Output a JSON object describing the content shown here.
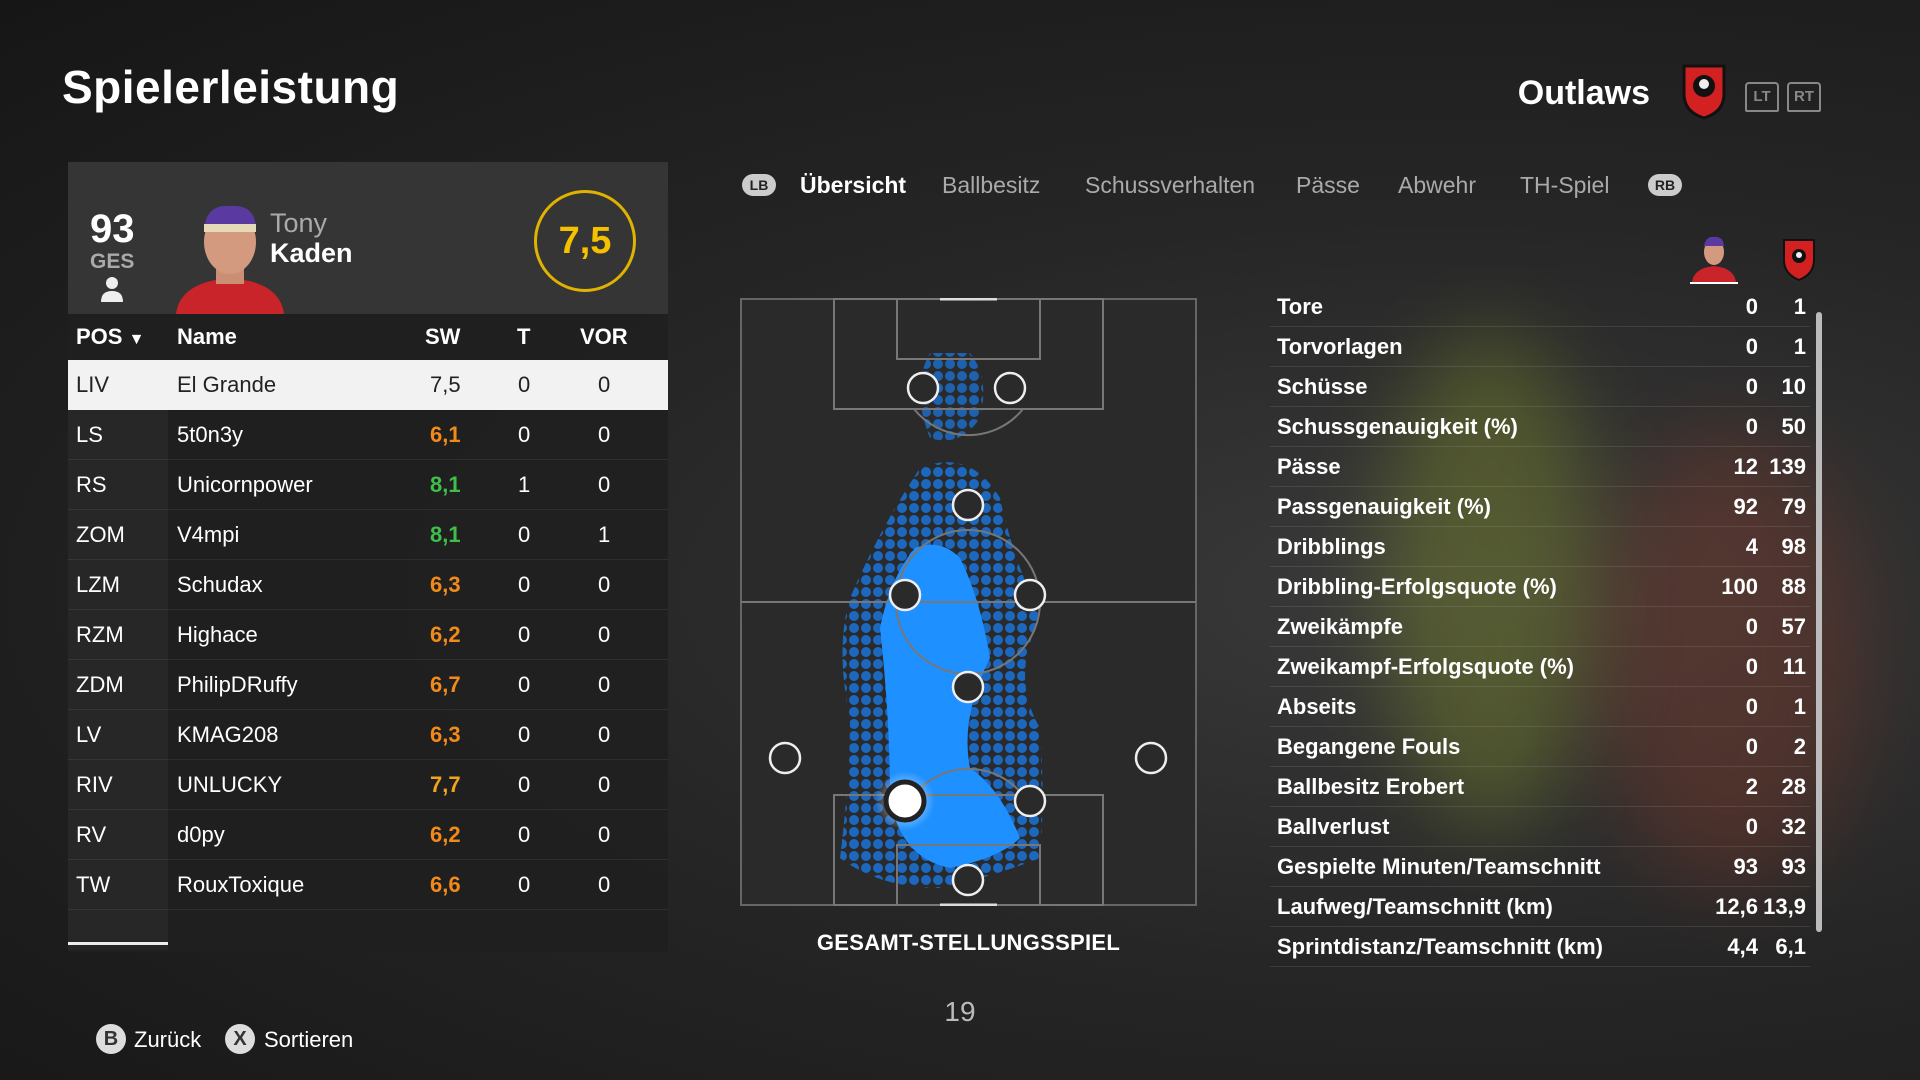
{
  "page_title": "Spielerleistung",
  "team": {
    "name": "Outlaws"
  },
  "triggers": {
    "lt": "LT",
    "rt": "RT"
  },
  "player": {
    "overall": "93",
    "overall_label": "GES",
    "first_name": "Tony",
    "last_name": "Kaden",
    "rating": "7,5"
  },
  "table": {
    "headers": {
      "pos": "POS",
      "name": "Name",
      "sw": "SW",
      "t": "T",
      "vor": "VOR"
    },
    "rows": [
      {
        "pos": "LIV",
        "name": "El Grande",
        "sw": "7,5",
        "t": "0",
        "vor": "0",
        "color": "#222222"
      },
      {
        "pos": "LS",
        "name": "5t0n3y",
        "sw": "6,1",
        "t": "0",
        "vor": "0",
        "color": "#f28a1a"
      },
      {
        "pos": "RS",
        "name": "Unicornpower",
        "sw": "8,1",
        "t": "1",
        "vor": "0",
        "color": "#3fbf4a"
      },
      {
        "pos": "ZOM",
        "name": "V4mpi",
        "sw": "8,1",
        "t": "0",
        "vor": "1",
        "color": "#3fbf4a"
      },
      {
        "pos": "LZM",
        "name": "Schudax",
        "sw": "6,3",
        "t": "0",
        "vor": "0",
        "color": "#f28a1a"
      },
      {
        "pos": "RZM",
        "name": "Highace",
        "sw": "6,2",
        "t": "0",
        "vor": "0",
        "color": "#f28a1a"
      },
      {
        "pos": "ZDM",
        "name": "PhilipDRuffy",
        "sw": "6,7",
        "t": "0",
        "vor": "0",
        "color": "#f28a1a"
      },
      {
        "pos": "LV",
        "name": "KMAG208",
        "sw": "6,3",
        "t": "0",
        "vor": "0",
        "color": "#f28a1a"
      },
      {
        "pos": "RIV",
        "name": "UNLUCKY",
        "sw": "7,7",
        "t": "0",
        "vor": "0",
        "color": "#f2a31a"
      },
      {
        "pos": "RV",
        "name": "d0py",
        "sw": "6,2",
        "t": "0",
        "vor": "0",
        "color": "#f28a1a"
      },
      {
        "pos": "TW",
        "name": "RouxToxique",
        "sw": "6,6",
        "t": "0",
        "vor": "0",
        "color": "#f28a1a"
      }
    ]
  },
  "tabs": {
    "lb": "LB",
    "rb": "RB",
    "items": [
      "Übersicht",
      "Ballbesitz",
      "Schussverhalten",
      "Pässe",
      "Abwehr",
      "TH-Spiel"
    ],
    "active": 0
  },
  "pitch": {
    "label": "GESAMT-STELLUNGSSPIEL"
  },
  "page_number": "19",
  "stats": [
    {
      "label": "Tore",
      "player": "0",
      "team": "1"
    },
    {
      "label": "Torvorlagen",
      "player": "0",
      "team": "1"
    },
    {
      "label": "Schüsse",
      "player": "0",
      "team": "10"
    },
    {
      "label": "Schussgenauigkeit (%)",
      "player": "0",
      "team": "50"
    },
    {
      "label": "Pässe",
      "player": "12",
      "team": "139"
    },
    {
      "label": "Passgenauigkeit (%)",
      "player": "92",
      "team": "79"
    },
    {
      "label": "Dribblings",
      "player": "4",
      "team": "98"
    },
    {
      "label": "Dribbling-Erfolgsquote (%)",
      "player": "100",
      "team": "88"
    },
    {
      "label": "Zweikämpfe",
      "player": "0",
      "team": "57"
    },
    {
      "label": "Zweikampf-Erfolgsquote (%)",
      "player": "0",
      "team": "11"
    },
    {
      "label": "Abseits",
      "player": "0",
      "team": "1"
    },
    {
      "label": "Begangene Fouls",
      "player": "0",
      "team": "2"
    },
    {
      "label": "Ballbesitz Erobert",
      "player": "2",
      "team": "28"
    },
    {
      "label": "Ballverlust",
      "player": "0",
      "team": "32"
    },
    {
      "label": "Gespielte Minuten/Teamschnitt",
      "player": "93",
      "team": "93"
    },
    {
      "label": "Laufweg/Teamschnitt (km)",
      "player": "12,6",
      "team": "13,9"
    },
    {
      "label": "Sprintdistanz/Teamschnitt (km)",
      "player": "4,4",
      "team": "6,1"
    }
  ],
  "footer": {
    "back_key": "B",
    "back_label": "Zurück",
    "sort_key": "X",
    "sort_label": "Sortieren"
  },
  "colors": {
    "rating_ring": "#e0b300",
    "heatmap": "#1e90ff",
    "crest_red": "#d32020"
  }
}
